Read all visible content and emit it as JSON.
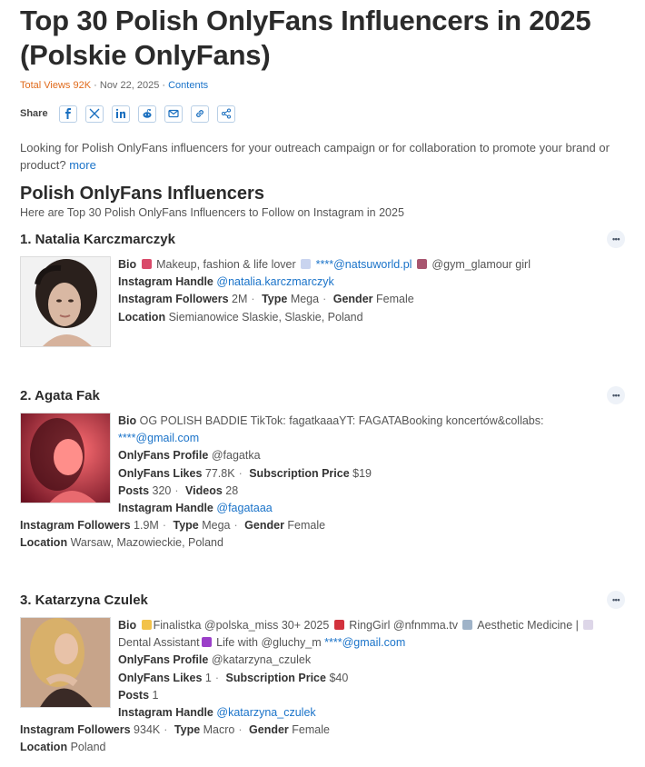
{
  "header": {
    "title_line1": "Top 30 Polish OnlyFans Influencers in 2025",
    "title_line2": "(Polskie OnlyFans)",
    "views": "Total Views 92K",
    "date": "Nov 22, 2025",
    "contents_link": "Contents"
  },
  "share": {
    "label": "Share",
    "icons": [
      "facebook-icon",
      "x-icon",
      "linkedin-icon",
      "reddit-icon",
      "email-icon",
      "link-icon",
      "share-icon"
    ]
  },
  "intro": {
    "text": "Looking for Polish OnlyFans influencers for your outreach campaign or for collaboration to promote your brand or product?",
    "more": "more"
  },
  "section": {
    "title": "Polish OnlyFans Influencers",
    "subtitle": "Here are Top 30 Polish OnlyFans Influencers to Follow on Instagram in 2025"
  },
  "labels": {
    "bio": "Bio",
    "ig_handle": "Instagram Handle",
    "ig_followers": "Instagram Followers",
    "type": "Type",
    "gender": "Gender",
    "location": "Location",
    "of_profile": "OnlyFans Profile",
    "of_likes": "OnlyFans Likes",
    "sub_price": "Subscription Price",
    "posts": "Posts",
    "videos": "Videos",
    "dots": "•••"
  },
  "influencers": [
    {
      "name": "1. Natalia Karczmarczyk",
      "bio_a": "Makeup, fashion & life lover",
      "bio_email": "****@natsuworld.pl",
      "bio_b": "@gym_glamour girl",
      "ig_handle": "@natalia.karczmarczyk",
      "ig_followers": "2M",
      "type": "Mega",
      "gender": "Female",
      "location": "Siemianowice Slaskie, Slaskie, Poland"
    },
    {
      "name": "2. Agata Fak",
      "bio_a": "OG POLISH BADDIE TikTok: fagatkaaaYT: FAGATABooking koncertów&collabs:",
      "bio_email": "****@gmail.com",
      "of_profile": "@fagatka",
      "of_likes": "77.8K",
      "sub_price": "$19",
      "posts": "320",
      "videos": "28",
      "ig_handle": "@fagataaa",
      "ig_followers": "1.9M",
      "type": "Mega",
      "gender": "Female",
      "location": "Warsaw, Mazowieckie, Poland"
    },
    {
      "name": "3. Katarzyna Czulek",
      "bio_a": "Finalistka @polska_miss 30+ 2025",
      "bio_b": "RingGirl @nfnmma.tv",
      "bio_c": "Aesthetic Medicine |",
      "bio_d": "Dental Assistant",
      "bio_e": "Life with @gluchy_m",
      "bio_email": "****@gmail.com",
      "of_profile": "@katarzyna_czulek",
      "of_likes": "1",
      "sub_price": "$40",
      "posts": "1",
      "ig_handle": "@katarzyna_czulek",
      "ig_followers": "934K",
      "type": "Macro",
      "gender": "Female",
      "location": "Poland"
    }
  ]
}
